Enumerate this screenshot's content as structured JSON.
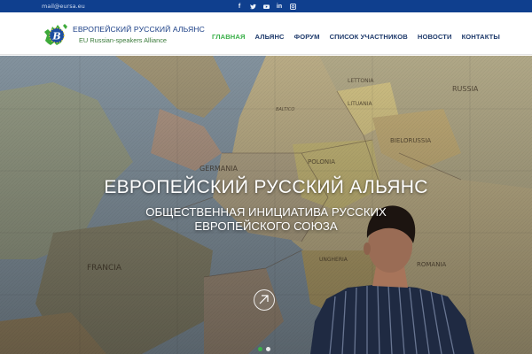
{
  "topbar": {
    "email": "mail@eursa.eu",
    "social": [
      "facebook-icon",
      "twitter-icon",
      "youtube-icon",
      "linkedin-icon",
      "instagram-icon"
    ]
  },
  "header": {
    "logo_title": "ЕВРОПЕЙСКИЙ РУССКИЙ АЛЬЯНС",
    "logo_subtitle": "EU Russian-speakers Alliance",
    "nav": [
      {
        "label": "ГЛАВНАЯ",
        "active": true
      },
      {
        "label": "АЛЬЯНС",
        "active": false
      },
      {
        "label": "ФОРУМ",
        "active": false
      },
      {
        "label": "СПИСОК УЧАСТНИКОВ",
        "active": false
      },
      {
        "label": "НОВОСТИ",
        "active": false
      },
      {
        "label": "КОНТАКТЫ",
        "active": false
      }
    ]
  },
  "hero": {
    "title": "ЕВРОПЕЙСКИЙ РУССКИЙ АЛЬЯНС",
    "subtitle": "ОБЩЕСТВЕННАЯ ИНИЦИАТИВА РУССКИХ ЕВРОПЕЙСКОГО СОЮЗА",
    "map_labels": [
      "LETTONIA",
      "LITUANIA",
      "BIELORUSSIA",
      "POLONIA",
      "GERMANIA",
      "FRANCIA",
      "ROMANIA",
      "UNGHERIA",
      "BALTICO",
      "RUSSIA"
    ],
    "slides_total": 2,
    "slide_active": 1
  },
  "colors": {
    "topbar": "#0f3f8e",
    "accent_green": "#3bb04a",
    "nav_text": "#1e3a6b",
    "logo_blue": "#1b3f86"
  }
}
